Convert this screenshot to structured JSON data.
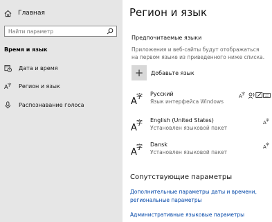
{
  "sidebar": {
    "home_label": "Главная",
    "search_placeholder": "Найти параметр",
    "section_title": "Время и язык",
    "items": [
      {
        "label": "Дата и время",
        "icon": "calendar-clock-icon"
      },
      {
        "label": "Регион и язык",
        "icon": "language-icon"
      },
      {
        "label": "Распознавание голоса",
        "icon": "microphone-icon"
      }
    ]
  },
  "main": {
    "title": "Регион и язык",
    "preferred_heading": "Предпочитаемые языки",
    "preferred_desc": "Приложения и веб-сайты будут отображаться на первом языке из приведенного ниже списка.",
    "add_language_label": "Добавьте язык",
    "languages": [
      {
        "name": "Русский",
        "status": "Язык интерфейса Windows",
        "features": [
          "language-pack-icon",
          "speech-icon",
          "handwriting-icon",
          "keyboard-icon"
        ]
      },
      {
        "name": "English (United States)",
        "status": "Установлен языковой пакет",
        "features": [
          "language-pack-icon"
        ]
      },
      {
        "name": "Dansk",
        "status": "Установлен языковой пакет",
        "features": [
          "language-pack-icon"
        ]
      }
    ],
    "related_heading": "Сопутствующие параметры",
    "related_links": [
      "Дополнительные параметры даты и времени,",
      "региональные параметры",
      "Административные языковые параметры"
    ]
  },
  "colors": {
    "sidebar_bg": "#e6e6e6",
    "link": "#0046a8",
    "secondary_text": "#666666"
  }
}
